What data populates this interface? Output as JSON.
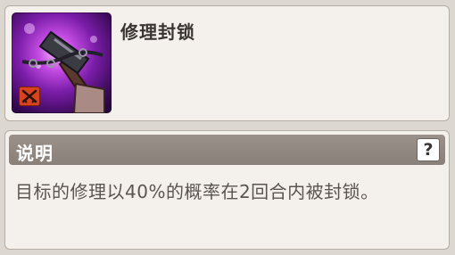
{
  "skill": {
    "name": "修理封锁",
    "icon": "hammer-icon",
    "badge_icon": "crossed-swords-icon"
  },
  "description": {
    "title": "说明",
    "help_label": "?",
    "text": "目标的修理以40%的概率在2回合内被封锁。"
  },
  "colors": {
    "icon_bg": "#7a1da8",
    "badge_bg": "#d8421e",
    "header_bg": "#8f8680"
  }
}
